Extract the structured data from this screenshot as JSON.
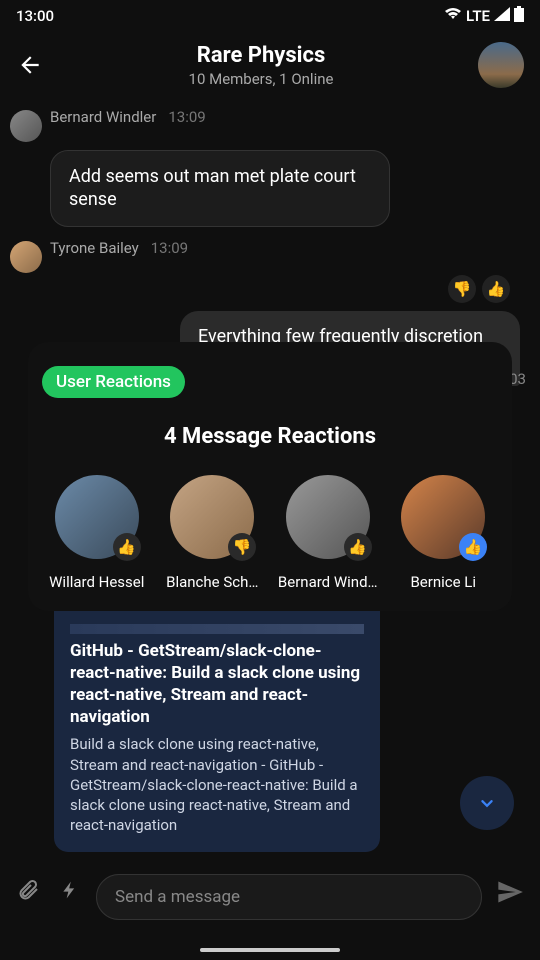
{
  "status": {
    "time": "13:00",
    "network": "LTE"
  },
  "header": {
    "title": "Rare Physics",
    "subtitle": "10 Members, 1 Online"
  },
  "msg1": {
    "name": "Bernard Windler",
    "time": "13:09",
    "text": "Add seems out man met plate court sense"
  },
  "msg2": {
    "name": "Tyrone Bailey",
    "time": "13:09"
  },
  "outmsg": {
    "text": "Everything few frequently discretion surrounded did simplicity decisively"
  },
  "peek": {
    "count": "03"
  },
  "modal": {
    "pill": "User Reactions",
    "title": "4 Message Reactions",
    "reactors": {
      "0": {
        "name": "Willard Hessel"
      },
      "1": {
        "name": "Blanche Sch…"
      },
      "2": {
        "name": "Bernard Wind…"
      },
      "3": {
        "name": "Bernice Li"
      }
    }
  },
  "link": {
    "title": "GitHub - GetStream/slack-clone-react-native: Build a slack clone using react-native, Stream and react-navigation",
    "desc": "Build a slack clone using react-native, Stream and react-navigation - GitHub - GetStream/slack-clone-react-native: Build a slack clone using react-native, Stream and react-navigation"
  },
  "composer": {
    "placeholder": "Send a message"
  }
}
